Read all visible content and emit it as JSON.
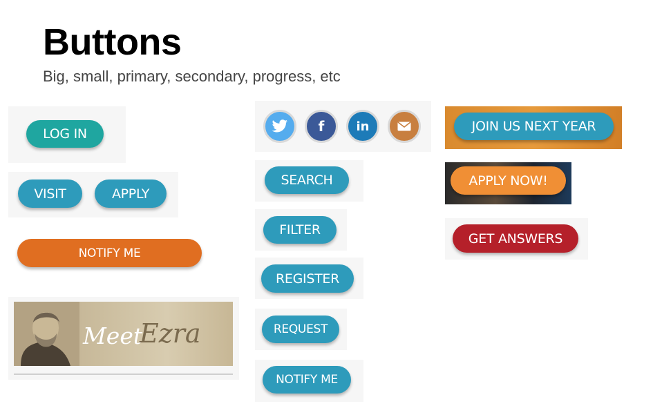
{
  "header": {
    "title": "Buttons",
    "subtitle": "Big, small, primary, secondary, progress, etc"
  },
  "left_column": {
    "login_label": "LOG IN",
    "visit_label": "VISIT",
    "apply_label": "APPLY",
    "notify_wide_label": "NOTIFY ME",
    "ezra_banner": {
      "meet": "Meet",
      "name": "Ezra"
    }
  },
  "middle_column": {
    "social_icons": [
      {
        "name": "twitter-icon",
        "glyph": "🐦",
        "color": "#55acee"
      },
      {
        "name": "facebook-icon",
        "glyph": "f",
        "color": "#3b5998"
      },
      {
        "name": "linkedin-icon",
        "glyph": "in",
        "color": "#1d7bb8"
      },
      {
        "name": "email-icon",
        "glyph": "✉",
        "color": "#c87f3f"
      }
    ],
    "search_label": "SEARCH",
    "filter_label": "FILTER",
    "register_label": "REGISTER",
    "request_label": "REQUEST",
    "notify_label": "NOTIFY ME"
  },
  "right_column": {
    "join_label": "JOIN US NEXT YEAR",
    "apply_now_label": "APPLY NOW!",
    "get_answers_label": "GET ANSWERS"
  },
  "colors": {
    "teal": "#2e9bbb",
    "green": "#1fa6a0",
    "orange": "#e06e21",
    "orange_light": "#f08f35",
    "red": "#b5202a"
  }
}
